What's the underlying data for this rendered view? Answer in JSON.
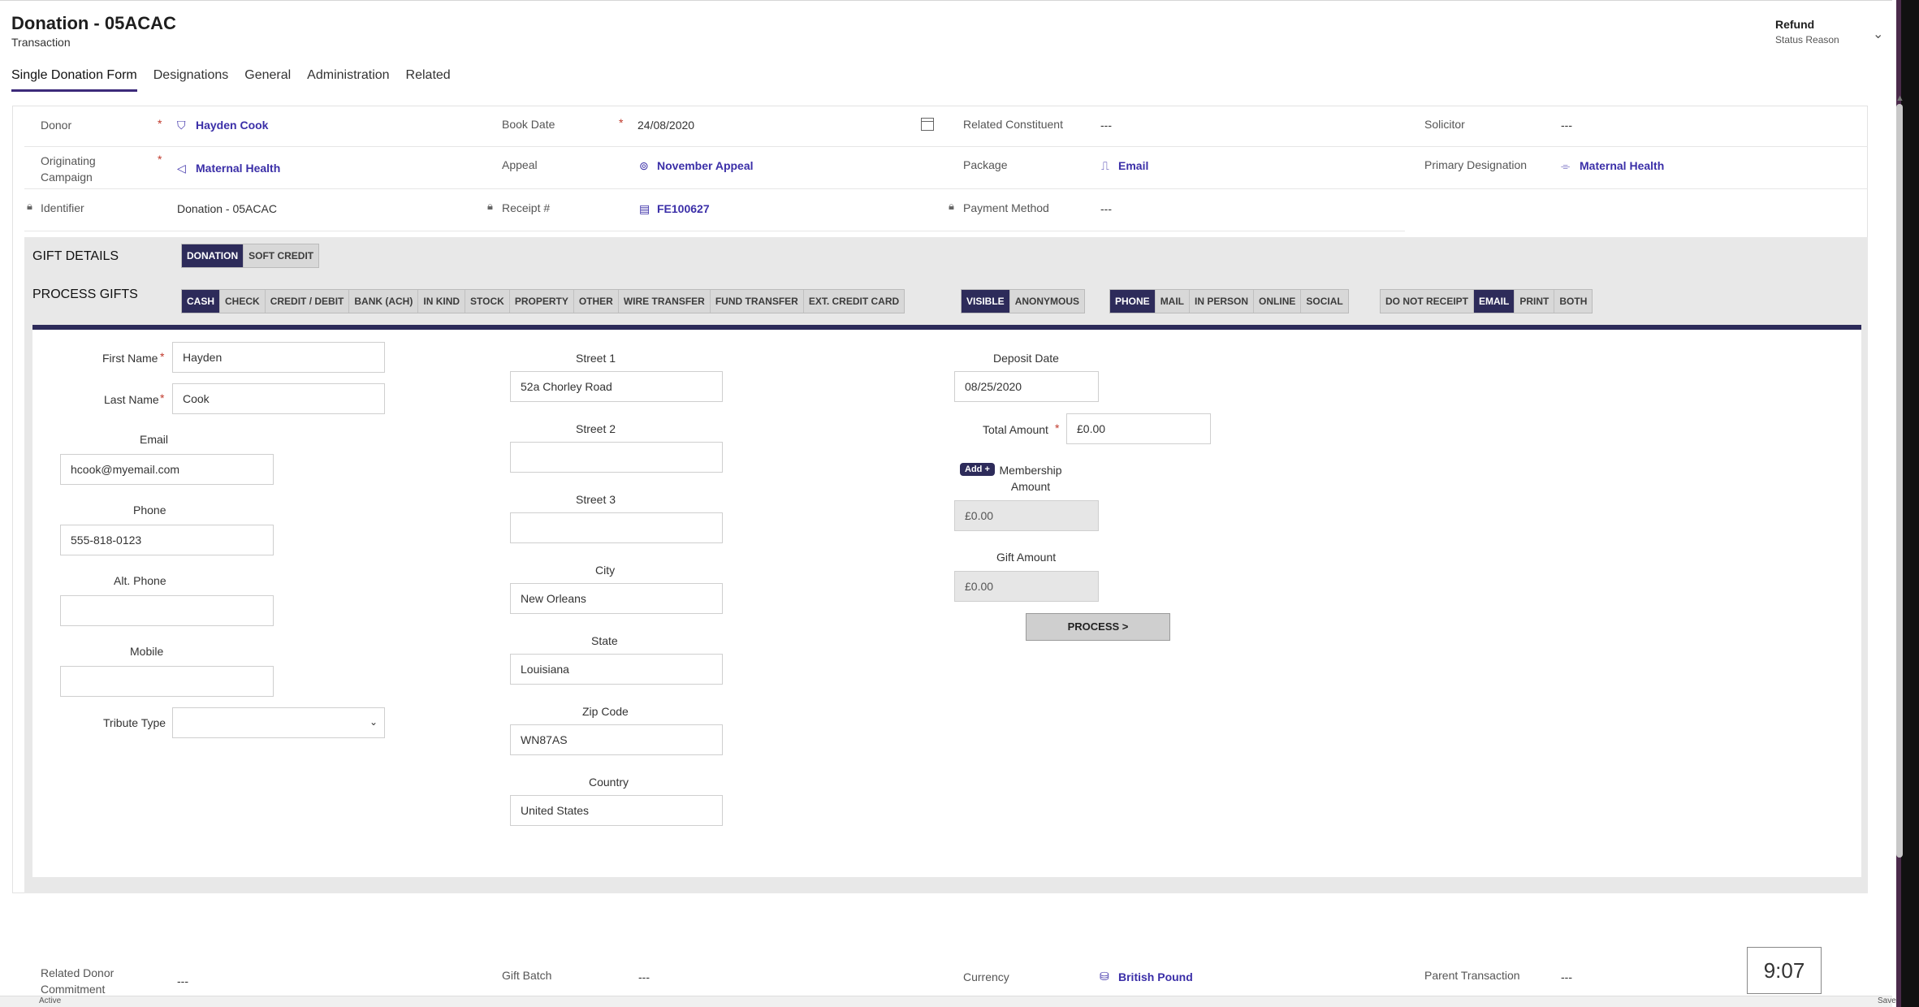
{
  "header": {
    "title": "Donation - 05ACAC",
    "entity": "Transaction",
    "status_value": "Refund",
    "status_label": "Status Reason"
  },
  "tabs": [
    {
      "label": "Single Donation Form",
      "active": true
    },
    {
      "label": "Designations"
    },
    {
      "label": "General"
    },
    {
      "label": "Administration"
    },
    {
      "label": "Related"
    }
  ],
  "fields": {
    "donor_label": "Donor",
    "donor_value": "Hayden Cook",
    "book_date_label": "Book Date",
    "book_date_value": "24/08/2020",
    "related_constituent_label": "Related Constituent",
    "related_constituent_value": "---",
    "solicitor_label": "Solicitor",
    "solicitor_value": "---",
    "originating_campaign_label": "Originating Campaign",
    "originating_campaign_value": "Maternal Health",
    "appeal_label": "Appeal",
    "appeal_value": "November Appeal",
    "package_label": "Package",
    "package_value": "Email",
    "primary_designation_label": "Primary Designation",
    "primary_designation_value": "Maternal Health",
    "identifier_label": "Identifier",
    "identifier_value": "Donation - 05ACAC",
    "receipt_label": "Receipt #",
    "receipt_value": "FE100627",
    "payment_method_label": "Payment Method",
    "payment_method_value": "---"
  },
  "gift_details": {
    "title": "GIFT DETAILS",
    "options": [
      "DONATION",
      "SOFT CREDIT"
    ],
    "selected": "DONATION"
  },
  "process_gifts": {
    "title": "PROCESS GIFTS",
    "payment_types": [
      "CASH",
      "CHECK",
      "CREDIT / DEBIT",
      "BANK (ACH)",
      "IN KIND",
      "STOCK",
      "PROPERTY",
      "OTHER",
      "WIRE TRANSFER",
      "FUND TRANSFER",
      "EXT. CREDIT CARD"
    ],
    "payment_selected": "CASH",
    "visibility": [
      "VISIBLE",
      "ANONYMOUS"
    ],
    "visibility_selected": "VISIBLE",
    "channels": [
      "PHONE",
      "MAIL",
      "IN PERSON",
      "ONLINE",
      "SOCIAL"
    ],
    "channel_selected": "PHONE",
    "receipts": [
      "DO NOT RECEIPT",
      "EMAIL",
      "PRINT",
      "BOTH"
    ],
    "receipt_selected": "EMAIL"
  },
  "form": {
    "first_name_label": "First Name",
    "first_name": "Hayden",
    "last_name_label": "Last Name",
    "last_name": "Cook",
    "email_label": "Email",
    "email": "hcook@myemail.com",
    "phone_label": "Phone",
    "phone": "555-818-0123",
    "alt_phone_label": "Alt. Phone",
    "alt_phone": "",
    "mobile_label": "Mobile",
    "mobile": "",
    "tribute_type_label": "Tribute Type",
    "street1_label": "Street 1",
    "street1": "52a Chorley Road",
    "street2_label": "Street 2",
    "street2": "",
    "street3_label": "Street 3",
    "street3": "",
    "city_label": "City",
    "city": "New Orleans",
    "state_label": "State",
    "state": "Louisiana",
    "zip_label": "Zip Code",
    "zip": "WN87AS",
    "country_label": "Country",
    "country": "United States",
    "deposit_date_label": "Deposit Date",
    "deposit_date": "08/25/2020",
    "total_amount_label": "Total Amount",
    "total_amount": "£0.00",
    "add_label": "Add +",
    "membership_amount_label": "Membership Amount",
    "membership_amount": "£0.00",
    "gift_amount_label": "Gift Amount",
    "gift_amount": "£0.00",
    "process_button": "PROCESS >"
  },
  "lower": {
    "related_donor_commitment_label": "Related Donor Commitment",
    "related_donor_commitment_value": "---",
    "gift_batch_label": "Gift Batch",
    "gift_batch_value": "---",
    "currency_label": "Currency",
    "currency_value": "British Pound",
    "parent_transaction_label": "Parent Transaction",
    "parent_transaction_value": "---"
  },
  "clock": "9:07",
  "footer": {
    "status": "Active",
    "save": "Save"
  },
  "colors": {
    "accent": "#2d2b5a",
    "link": "#3b2fa8",
    "required": "#c0392b"
  }
}
